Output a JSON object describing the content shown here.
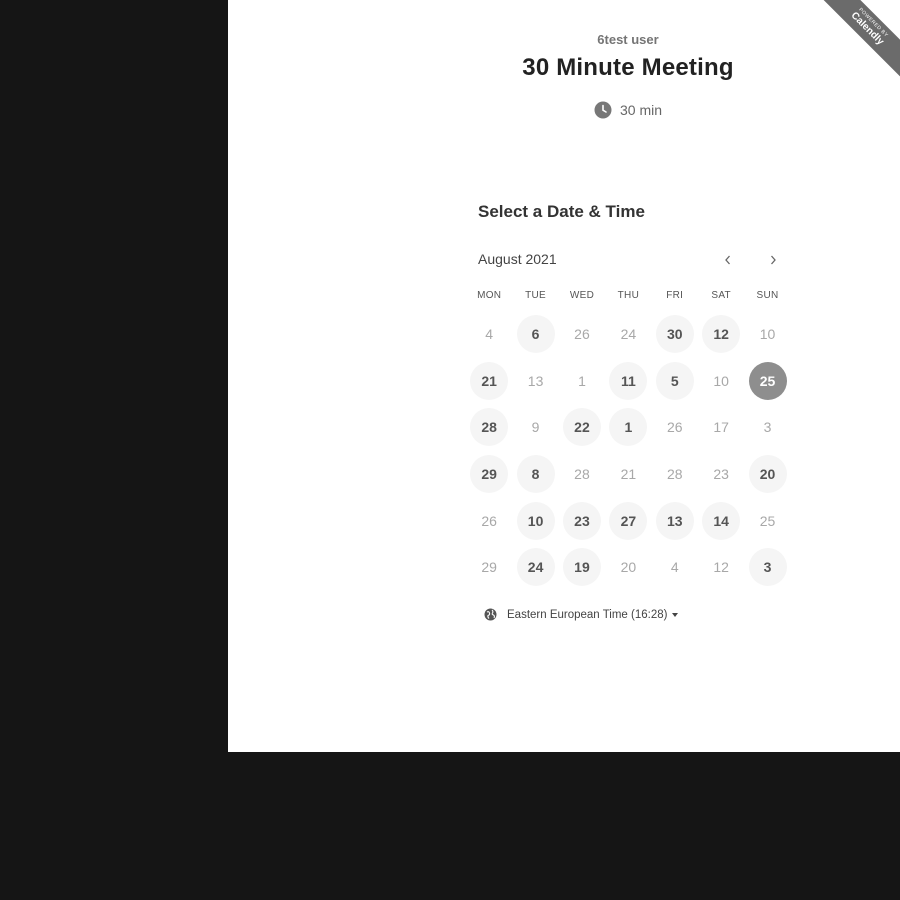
{
  "ribbon": {
    "top": "POWERED BY",
    "bottom": "Calendly"
  },
  "event": {
    "host": "6test user",
    "title": "30 Minute Meeting",
    "duration": "30 min"
  },
  "picker": {
    "heading": "Select a Date & Time",
    "month": "August 2021",
    "weekdays": [
      "MON",
      "TUE",
      "WED",
      "THU",
      "FRI",
      "SAT",
      "SUN"
    ],
    "weeks": [
      [
        {
          "d": "4",
          "s": "off"
        },
        {
          "d": "6",
          "s": "on"
        },
        {
          "d": "26",
          "s": "off"
        },
        {
          "d": "24",
          "s": "off"
        },
        {
          "d": "30",
          "s": "on"
        },
        {
          "d": "12",
          "s": "on"
        },
        {
          "d": "10",
          "s": "off"
        }
      ],
      [
        {
          "d": "21",
          "s": "on"
        },
        {
          "d": "13",
          "s": "off"
        },
        {
          "d": "1",
          "s": "off"
        },
        {
          "d": "11",
          "s": "on"
        },
        {
          "d": "5",
          "s": "on"
        },
        {
          "d": "10",
          "s": "off"
        },
        {
          "d": "25",
          "s": "sel"
        }
      ],
      [
        {
          "d": "28",
          "s": "on"
        },
        {
          "d": "9",
          "s": "off"
        },
        {
          "d": "22",
          "s": "on"
        },
        {
          "d": "1",
          "s": "on"
        },
        {
          "d": "26",
          "s": "off"
        },
        {
          "d": "17",
          "s": "off"
        },
        {
          "d": "3",
          "s": "off"
        }
      ],
      [
        {
          "d": "29",
          "s": "on"
        },
        {
          "d": "8",
          "s": "on"
        },
        {
          "d": "28",
          "s": "off"
        },
        {
          "d": "21",
          "s": "off"
        },
        {
          "d": "28",
          "s": "off"
        },
        {
          "d": "23",
          "s": "off"
        },
        {
          "d": "20",
          "s": "on"
        }
      ],
      [
        {
          "d": "26",
          "s": "off"
        },
        {
          "d": "10",
          "s": "on"
        },
        {
          "d": "23",
          "s": "on"
        },
        {
          "d": "27",
          "s": "on"
        },
        {
          "d": "13",
          "s": "on"
        },
        {
          "d": "14",
          "s": "on"
        },
        {
          "d": "25",
          "s": "off"
        }
      ],
      [
        {
          "d": "29",
          "s": "off"
        },
        {
          "d": "24",
          "s": "on"
        },
        {
          "d": "19",
          "s": "on"
        },
        {
          "d": "20",
          "s": "off"
        },
        {
          "d": "4",
          "s": "off"
        },
        {
          "d": "12",
          "s": "off"
        },
        {
          "d": "3",
          "s": "on"
        }
      ]
    ],
    "timezone": "Eastern European Time (16:28)"
  },
  "icons": {
    "duration": "clock-icon",
    "timezone": "globe-icon",
    "prev": "chevron-left-icon",
    "next": "chevron-right-icon"
  },
  "colors": {
    "background": "#151515",
    "panel": "#ffffff",
    "selected": "#8e8e8e",
    "available": "#f5f5f5"
  }
}
